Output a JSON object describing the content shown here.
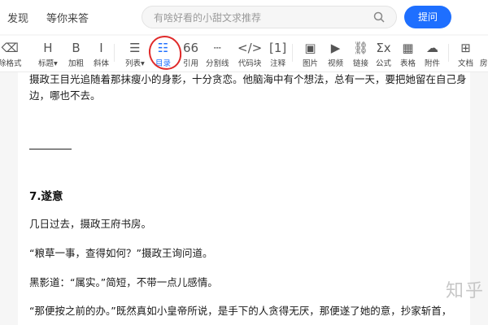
{
  "nav": {
    "discover": "发现",
    "wait_answer": "等你来答",
    "search_placeholder": "有啥好看的小甜文求推荐",
    "ask_button": "提问"
  },
  "toolbar": {
    "items": [
      {
        "icon": "eraser-icon",
        "glyph": "⌫",
        "label": "除格式"
      },
      {
        "icon": "heading-icon",
        "glyph": "H",
        "label": "标题▾"
      },
      {
        "icon": "bold-icon",
        "glyph": "B",
        "label": "加粗"
      },
      {
        "icon": "italic-icon",
        "glyph": "I",
        "label": "斜体"
      },
      {
        "icon": "list-icon",
        "glyph": "☰",
        "label": "列表▾"
      },
      {
        "icon": "toc-icon",
        "glyph": "☷",
        "label": "目录"
      },
      {
        "icon": "quote-icon",
        "glyph": "66",
        "label": "引用"
      },
      {
        "icon": "divider-icon",
        "glyph": "┄",
        "label": "分割线"
      },
      {
        "icon": "code-icon",
        "glyph": "</>",
        "label": "代码块"
      },
      {
        "icon": "footnote-icon",
        "glyph": "[1]",
        "label": "注释"
      },
      {
        "icon": "image-icon",
        "glyph": "▣",
        "label": "图片"
      },
      {
        "icon": "video-icon",
        "glyph": "▶",
        "label": "视频"
      },
      {
        "icon": "link-icon",
        "glyph": "⛓",
        "label": "链接"
      },
      {
        "icon": "formula-icon",
        "glyph": "Σx",
        "label": "公式"
      },
      {
        "icon": "table-icon",
        "glyph": "▦",
        "label": "表格"
      },
      {
        "icon": "attachment-icon",
        "glyph": "☁",
        "label": "附件"
      },
      {
        "icon": "document-icon",
        "glyph": "⊞",
        "label": "文档"
      },
      {
        "icon": "more-icon",
        "glyph": "",
        "label": "房"
      }
    ],
    "active_index": 5
  },
  "annotation": {
    "number": "3",
    "color": "#e02a2a"
  },
  "editor": {
    "top_line": "摄政王目光追随着那抹瘦小的身影，十分贪恋。他脑海中有个想法，总有一天，要把她留在自己身",
    "top_line_2": "边，哪也不去。",
    "heading": "7.遂意",
    "p1": "几日过去，摄政王府书房。",
    "p2": "“粮草一事，查得如何？”摄政王询问道。",
    "p3": "黑影道：“属实。”简短，不带一点儿感情。",
    "p4": "“那便按之前的办。”既然真如小皇帝所说，是手下的人贪得无厌，那便遂了她的意，抄家斩首，"
  },
  "watermark": "知乎",
  "colors": {
    "accent": "#1e6fff",
    "annotation": "#e02a2a"
  }
}
